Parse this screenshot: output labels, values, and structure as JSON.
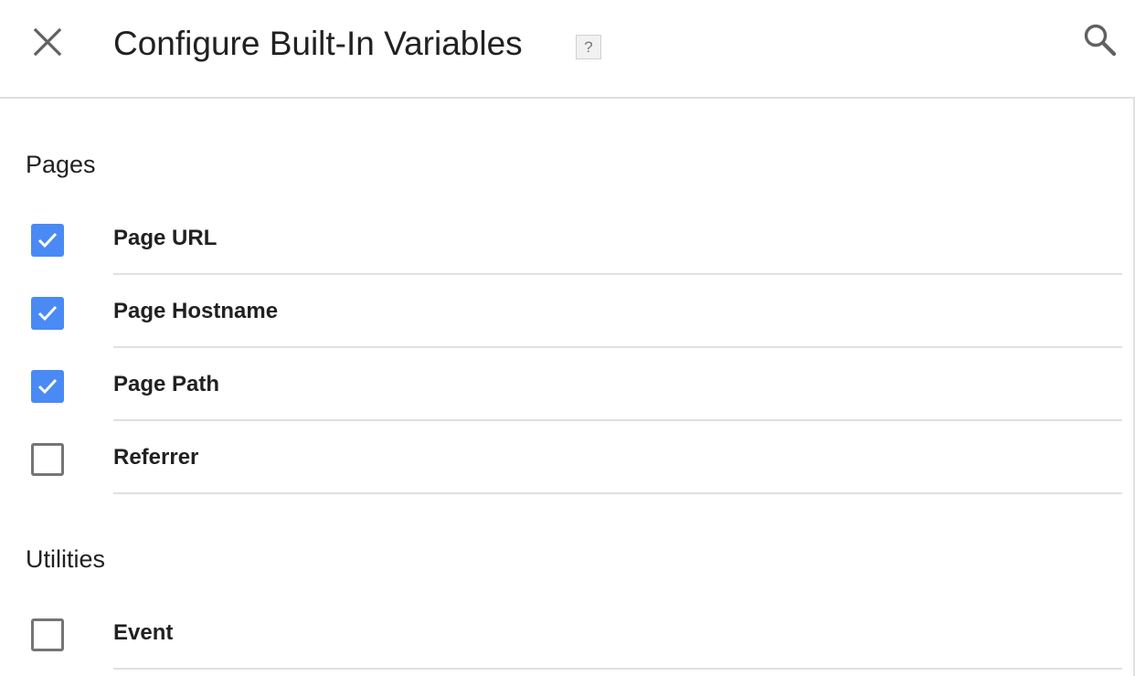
{
  "header": {
    "title": "Configure Built-In Variables",
    "help_label": "?",
    "close_icon": "close-icon",
    "search_icon": "search-icon"
  },
  "sections": [
    {
      "heading": "Pages",
      "items": [
        {
          "label": "Page URL",
          "checked": true
        },
        {
          "label": "Page Hostname",
          "checked": true
        },
        {
          "label": "Page Path",
          "checked": true
        },
        {
          "label": "Referrer",
          "checked": false
        }
      ]
    },
    {
      "heading": "Utilities",
      "items": [
        {
          "label": "Event",
          "checked": false
        }
      ]
    }
  ],
  "colors": {
    "checkbox_checked": "#4a8af4",
    "checkbox_border": "#757575",
    "divider": "#e0e0e0",
    "text": "#212121"
  }
}
